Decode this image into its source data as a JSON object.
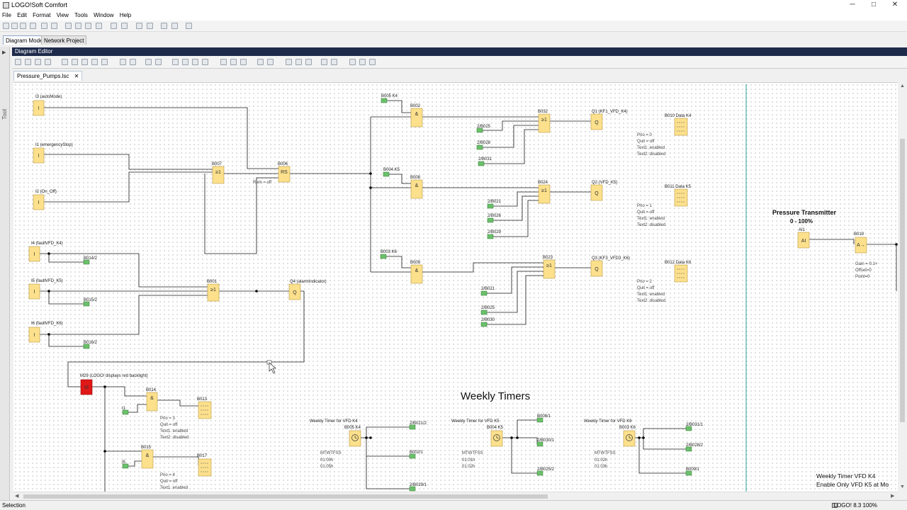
{
  "app": {
    "title": "LOGO!Soft Comfort"
  },
  "window_controls": {
    "minimize": "─",
    "maximize": "□",
    "close": "✕"
  },
  "menu": [
    "File",
    "Edit",
    "Format",
    "View",
    "Tools",
    "Window",
    "Help"
  ],
  "mode_tabs": [
    {
      "label": "Diagram Mode",
      "active": true
    },
    {
      "label": "Network Project",
      "active": false
    }
  ],
  "sidebar": {
    "arrow": "▶",
    "label": "Tool"
  },
  "editor": {
    "title": "Diagram Editor",
    "tab_label": "Pressure_Pumps.lsc",
    "tab_close": "✕"
  },
  "status": {
    "left": "Selection",
    "right": "LOGO! 8.3 100%"
  },
  "diagram": {
    "inputs": [
      {
        "name": "I3 (autoMode)",
        "symbol": "I"
      },
      {
        "name": "I1 (emergencyStop)",
        "symbol": "I"
      },
      {
        "name": "I2 (On_Off)",
        "symbol": "I"
      },
      {
        "name": "I4 (faultVFD_K4)",
        "symbol": "I"
      },
      {
        "name": "I5 (faultVFD_K5)",
        "symbol": "I"
      },
      {
        "name": "I6 (faultVFD_K6)",
        "symbol": "I"
      }
    ],
    "connectors_left": [
      "B014/2",
      "B015/2",
      "B016/2"
    ],
    "gates": {
      "B007": {
        "name": "B007",
        "symbol": "≥1"
      },
      "B006": {
        "name": "B006",
        "symbol": "RS",
        "note": "Rem = off"
      },
      "B001": {
        "name": "B001",
        "symbol": "≥1"
      },
      "Q4": {
        "name": "Q4 (alarmIndicator)",
        "symbol": "Q"
      },
      "B002": {
        "name": "B002",
        "symbol": "&"
      },
      "B008": {
        "name": "B008",
        "symbol": "&"
      },
      "B009": {
        "name": "B009",
        "symbol": "&"
      },
      "B032": {
        "name": "B032",
        "symbol": "≥1"
      },
      "B024": {
        "name": "B024",
        "symbol": "≥1"
      },
      "B023": {
        "name": "B023",
        "symbol": "≥1"
      },
      "Q1": {
        "name": "Q1 (KF1_VFD_K4)",
        "symbol": "Q"
      },
      "Q2": {
        "name": "Q2 (VFD_K5)",
        "symbol": "Q"
      },
      "Q3": {
        "name": "Q3 (KF3_VFD3_K6)",
        "symbol": "Q"
      },
      "B010": {
        "name": "B010 Data K4"
      },
      "B011": {
        "name": "B011 Data K5"
      },
      "B012": {
        "name": "B012 Data K6"
      }
    },
    "timer_refs": {
      "B005": "B005 K4",
      "B004": "B004 K5",
      "B003": "B003 K6"
    },
    "connectors_right": {
      "row1": [
        "2/B025",
        "2/B028",
        "2/B031"
      ],
      "row2": [
        "2/B021",
        "2/B026",
        "2/B029"
      ],
      "row3": [
        "2/B021",
        "2/B025",
        "2/B030"
      ]
    },
    "params": {
      "b010": [
        "Prio = 0",
        "Quit = off",
        "Text1: enabled",
        "Text2: disabled"
      ],
      "b011": [
        "Prio = 1",
        "Quit = off",
        "Text1: enabled",
        "Text2: disabled"
      ],
      "b012": [
        "Prio = 2",
        "Quit = off",
        "Text1: enabled",
        "Text2: disabled"
      ],
      "b013": [
        "Prio = 3",
        "Quit = off",
        "Text1: enabled",
        "Text2: disabled"
      ],
      "b017": [
        "Prio = 4",
        "Quit = off",
        "Text1: enabled"
      ]
    },
    "flag": {
      "name": "M29 (LOGO! displays red backlight)",
      "symbol": "M"
    },
    "lower_blocks": {
      "B014": {
        "name": "B014",
        "symbol": "&"
      },
      "B013": {
        "name": "B013"
      },
      "B015": {
        "name": "B015",
        "symbol": "&"
      },
      "B017": {
        "name": "B017"
      }
    },
    "lower_conns": [
      "I1",
      "I5"
    ],
    "pressure": {
      "title": "Pressure Transmitter",
      "range": "0 - 100%",
      "ai_label": "AI1",
      "ai_symbol": "AI",
      "amp_name": "B019",
      "amp_symbol": "A→",
      "amp_params": [
        "Gain = 0.1+",
        "Offset=0",
        "Point=0"
      ]
    },
    "weekly": {
      "title": "Weekly Timers",
      "t1": {
        "label": "Weekly Timer for VFD K4",
        "block": "B005 K4",
        "outs": [
          "2/B021/2",
          "B002/1",
          "2/B029/1"
        ],
        "params": [
          "MTWTFSS",
          "01:00h",
          "01:05h"
        ]
      },
      "t2": {
        "label": "Weekly Timer for VFD K5",
        "block": "B004 K5",
        "outs": [
          "B008/1",
          "2/B030/1",
          "2/B025/2"
        ],
        "params": [
          "MTWTFSS",
          "01:01h",
          "01:02h"
        ]
      },
      "t3": {
        "label": "Weekly Timer for VFD K6",
        "block": "B003 K6",
        "outs": [
          "2/B031/1",
          "2/B028/2",
          "B009/1"
        ],
        "params": [
          "MTWTFSS",
          "01:02h",
          "01:03h"
        ]
      }
    },
    "note": {
      "line1": "Weekly Timer VFD K4",
      "line2": "Enable Only VFD K5 at Mo"
    }
  }
}
